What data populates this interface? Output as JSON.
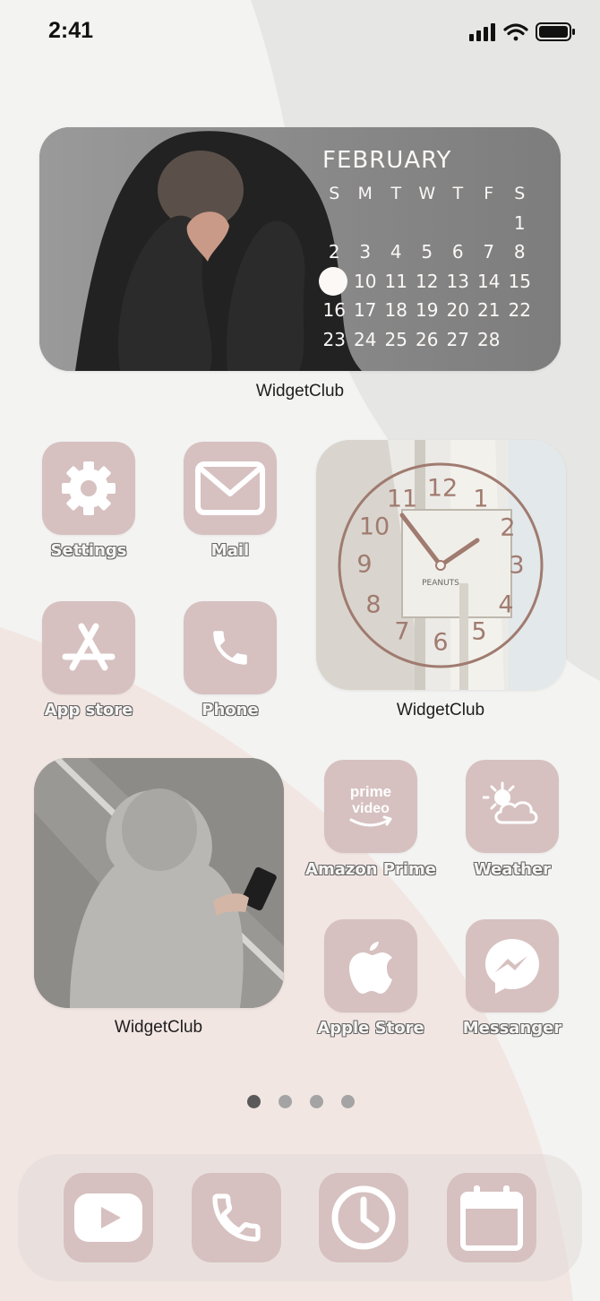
{
  "status_bar": {
    "time": "2:41"
  },
  "calendar_widget": {
    "month": "FEBRUARY",
    "weekdays": [
      "S",
      "M",
      "T",
      "W",
      "T",
      "F",
      "S"
    ],
    "weeks": [
      [
        "",
        "",
        "",
        "",
        "",
        "",
        "1"
      ],
      [
        "2",
        "3",
        "4",
        "5",
        "6",
        "7",
        "8"
      ],
      [
        "9",
        "10",
        "11",
        "12",
        "13",
        "14",
        "15"
      ],
      [
        "16",
        "17",
        "18",
        "19",
        "20",
        "21",
        "22"
      ],
      [
        "23",
        "24",
        "25",
        "26",
        "27",
        "28",
        ""
      ]
    ],
    "today": "9",
    "label": "WidgetClub"
  },
  "clock_widget": {
    "numbers": [
      "12",
      "1",
      "2",
      "3",
      "4",
      "5",
      "6",
      "7",
      "8",
      "9",
      "10",
      "11"
    ],
    "sign_text": "PEANUTS",
    "label": "WidgetClub"
  },
  "photo_widget": {
    "label": "WidgetClub"
  },
  "apps": {
    "settings": {
      "label": "Settings",
      "icon": "gear-icon"
    },
    "mail": {
      "label": "Mail",
      "icon": "envelope-icon"
    },
    "app_store": {
      "label": "App store",
      "icon": "app-store-icon"
    },
    "phone": {
      "label": "Phone",
      "icon": "phone-icon"
    },
    "amazon_prime": {
      "label": "Amazon Prime",
      "icon": "prime-video-icon",
      "logo_top": "prime",
      "logo_bottom": "video"
    },
    "weather": {
      "label": "Weather",
      "icon": "sun-cloud-icon"
    },
    "apple_store": {
      "label": "Apple Store",
      "icon": "apple-icon"
    },
    "messenger": {
      "label": "Messanger",
      "icon": "messenger-icon"
    }
  },
  "page_indicator": {
    "count": 4,
    "active": 0
  },
  "dock": {
    "items": [
      {
        "name": "youtube",
        "icon": "youtube-icon"
      },
      {
        "name": "phone",
        "icon": "phone-icon"
      },
      {
        "name": "clock",
        "icon": "clock-icon"
      },
      {
        "name": "calendar",
        "icon": "calendar-icon"
      }
    ]
  },
  "colors": {
    "icon_bg": "#d6c1c0",
    "icon_fg": "#ffffff",
    "background": "#f3f3f2",
    "accent_pink": "#f1e6e3",
    "clock_brown": "#a07b70"
  }
}
